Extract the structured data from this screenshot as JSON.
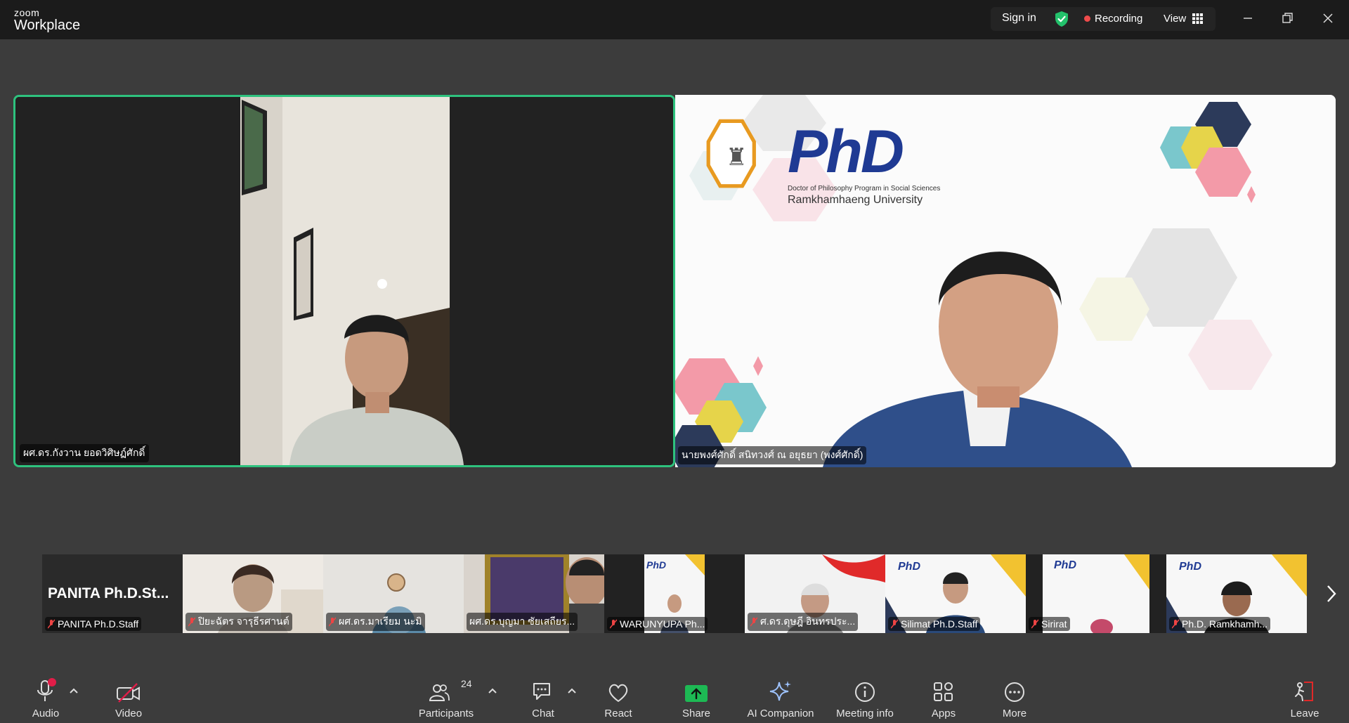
{
  "app": {
    "brand_top": "zoom",
    "brand_bottom": "Workplace"
  },
  "topbar": {
    "sign_in": "Sign in",
    "recording": "Recording",
    "view": "View"
  },
  "colors": {
    "accent_green": "#2ec27e",
    "recording_red": "#ef4b4b",
    "share_green": "#1db954",
    "leave_red": "#e02828"
  },
  "main_tiles": [
    {
      "name": "ผศ.ดร.กังวาน ยอดวิศิษฏ์ศักดิ์"
    },
    {
      "name": "นายพงศ์ศักดิ์ สนิทวงศ์ ณ อยุธยา (พงศ์ศักดิ์)"
    }
  ],
  "slide": {
    "phd": "PhD",
    "subtitle": "Doctor of Philosophy Program in Social Sciences",
    "university": "Ramkhamhaeng University"
  },
  "thumbnails": [
    {
      "display": "PANITA  Ph.D.St...",
      "name": "PANITA Ph.D.Staff",
      "muted": true
    },
    {
      "name": "ปิยะฉัตร จารุธีรศานต์",
      "muted": true
    },
    {
      "name": "ผศ.ดร.มาเรียม นะมิ",
      "muted": true
    },
    {
      "name": "ผศ.ดร.บุญมา ซัยเสถียร...",
      "muted": false
    },
    {
      "name": "WARUNYUPA Ph...",
      "muted": true
    },
    {
      "name": "ศ.ดร.ดุษฎี อินทรประ...",
      "muted": true
    },
    {
      "name": "Silimat Ph.D.Staff",
      "muted": true
    },
    {
      "name": "Sirirat",
      "muted": true
    },
    {
      "name": "Ph.D. Ramkhamh...",
      "muted": true
    }
  ],
  "toolbar": {
    "audio": "Audio",
    "video": "Video",
    "participants": "Participants",
    "participants_count": "24",
    "chat": "Chat",
    "react": "React",
    "share": "Share",
    "ai_companion": "AI Companion",
    "meeting_info": "Meeting info",
    "apps": "Apps",
    "more": "More",
    "leave": "Leave"
  }
}
